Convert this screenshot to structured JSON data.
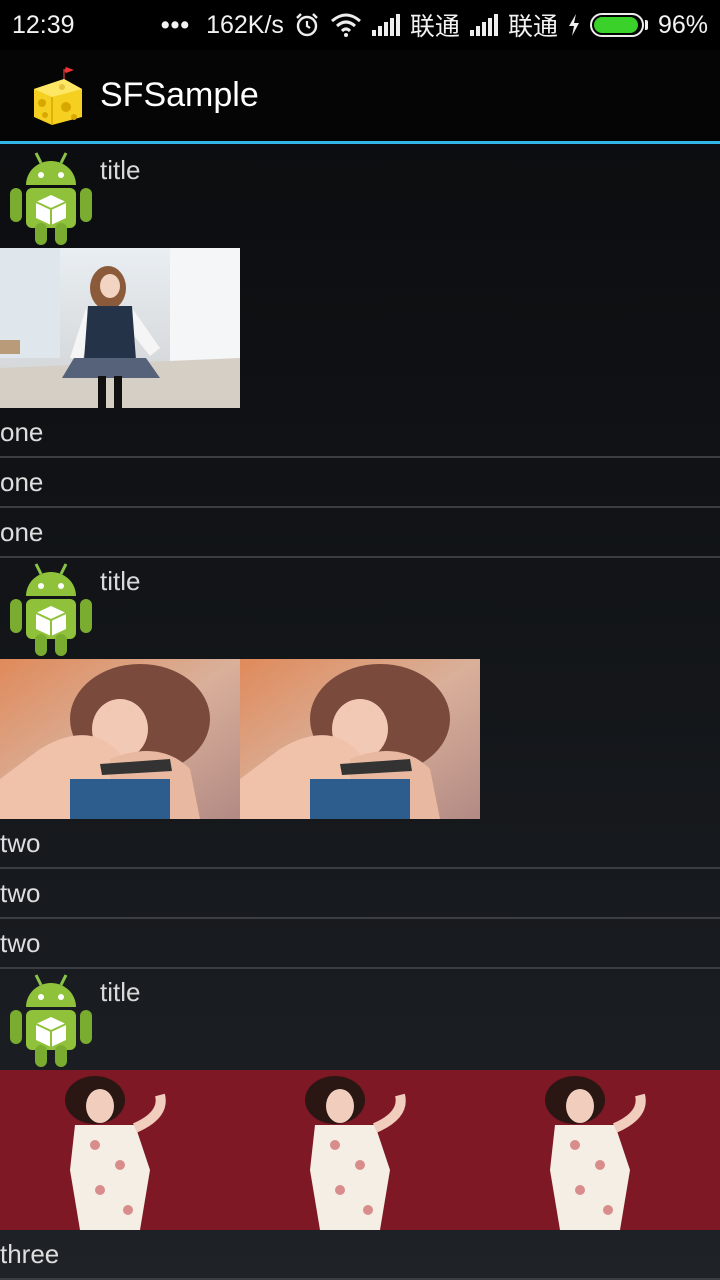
{
  "status": {
    "time": "12:39",
    "dots": "•••",
    "net_speed": "162K/s",
    "carrier1": "联通",
    "carrier2": "联通",
    "battery": "96%",
    "battery_level": 0.96,
    "battery_color": "#3ad12a"
  },
  "app": {
    "title": "SFSample",
    "accent": "#33b5e5",
    "icon": "cheese-icon"
  },
  "groups": [
    {
      "title": "title",
      "images": [
        "photo-girl-corridor"
      ],
      "items": [
        "one",
        "one",
        "one"
      ]
    },
    {
      "title": "title",
      "images": [
        "photo-girl-pink",
        "photo-girl-pink"
      ],
      "items": [
        "two",
        "two",
        "two"
      ]
    },
    {
      "title": "title",
      "images": [
        "photo-girl-red-dress",
        "photo-girl-red-dress",
        "photo-girl-red-dress"
      ],
      "items": [
        "three"
      ]
    }
  ]
}
